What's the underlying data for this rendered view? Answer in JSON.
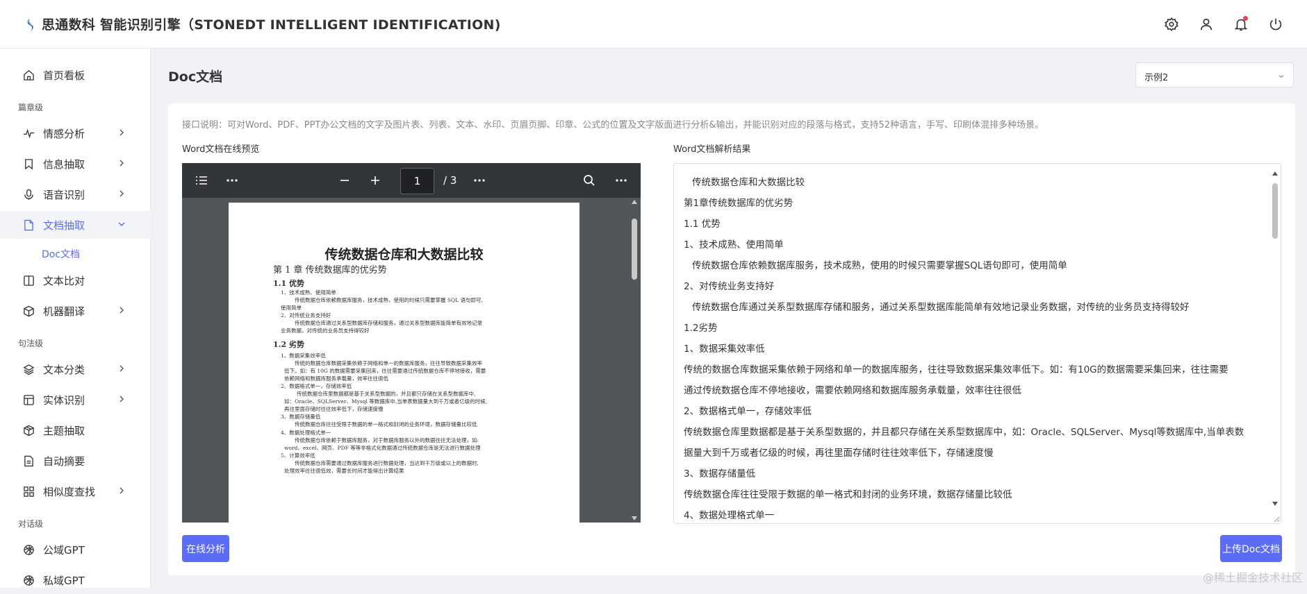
{
  "header": {
    "app_title": "思通数科 智能识别引擎（STONEDT INTELLIGENT IDENTIFICATION)",
    "icons": [
      "settings-icon",
      "user-icon",
      "bell-icon",
      "power-icon"
    ],
    "accent_color": "#5b6cf9"
  },
  "sidebar": {
    "items": [
      {
        "label": "首页看板",
        "icon": "home-icon"
      },
      {
        "group": "篇章级"
      },
      {
        "label": "情感分析",
        "icon": "pulse-icon",
        "has_arrow": true
      },
      {
        "label": "信息抽取",
        "icon": "bookmark-icon",
        "has_arrow": true
      },
      {
        "label": "语音识别",
        "icon": "mic-icon",
        "has_arrow": true
      },
      {
        "label": "文档抽取",
        "icon": "file-icon",
        "active": true,
        "expanded": true
      },
      {
        "sub": "Doc文档"
      },
      {
        "label": "文本比对",
        "icon": "columns-icon"
      },
      {
        "label": "机器翻译",
        "icon": "cube-icon",
        "has_arrow": true
      },
      {
        "group": "句法级"
      },
      {
        "label": "文本分类",
        "icon": "layers-icon",
        "has_arrow": true
      },
      {
        "label": "实体识别",
        "icon": "table-icon",
        "has_arrow": true
      },
      {
        "label": "主题抽取",
        "icon": "box-icon"
      },
      {
        "label": "自动摘要",
        "icon": "doc-icon"
      },
      {
        "label": "相似度查找",
        "icon": "grid-icon",
        "has_arrow": true
      },
      {
        "group": "对话级"
      },
      {
        "label": "公域GPT",
        "icon": "openai-icon"
      },
      {
        "label": "私域GPT",
        "icon": "openai-icon"
      }
    ]
  },
  "main": {
    "page_title": "Doc文档",
    "example_select": "示例2",
    "description": "接口说明：可对Word、PDF、PPT办公文档的文字及图片表、列表、文本、水印、页眉页脚、印章、公式的位置及文字版面进行分析&输出，并能识别对应的段落与格式，支持52种语言，手写、印刷体混排多种场景。",
    "preview_label": "Word文档在线预览",
    "result_label": "Word文档解析结果",
    "analyze_button": "在线分析",
    "upload_button": "上传Doc文档"
  },
  "viewer": {
    "page_number": "1",
    "page_total": "/ 3",
    "doc_title": "传统数据仓库和大数据比较",
    "lines": [
      {
        "text": "第 1 章    传统数据库的优劣势",
        "cls": "pdf-h1"
      },
      {
        "text": "1.1 优势",
        "cls": "pdf-h2"
      },
      {
        "text": "1、技术成熟、使用简单",
        "cls": "pdf-body"
      },
      {
        "text": "传统数据仓库依赖数据库服务，技术成熟，使用的时候只需要掌握 SQL 语句即可,",
        "cls": "pdf-body"
      },
      {
        "text": "使用简单",
        "cls": "pdf-body"
      },
      {
        "text": "2、对传统业务支持好",
        "cls": "pdf-body"
      },
      {
        "text": "传统数据仓库通过关系型数据库存储和服务，通过关系型数据库能简单有效地记录",
        "cls": "pdf-body"
      },
      {
        "text": "业务数据，对传统的业务员支持得较好",
        "cls": "pdf-body"
      },
      {
        "text": "1.2 劣势",
        "cls": "pdf-h2"
      },
      {
        "text": "1、数据采集效率低",
        "cls": "pdf-body"
      },
      {
        "text": "传统的数据仓库数据采集依赖于网络和单一的数据库服务，往往导致数据采集效率",
        "cls": "pdf-body"
      },
      {
        "text": "低下。如：有 10G 的数据需要采集回来，往往需要通过传统数据仓库不停地接收，需要",
        "cls": "pdf-body"
      },
      {
        "text": "依赖网络和数据库服务承载量，效率往往很低",
        "cls": "pdf-body"
      },
      {
        "text": "2、数据格式单一，存储效率低",
        "cls": "pdf-body"
      },
      {
        "text": "传统数据仓库里数据都是基于关系型数据的，并且都只存储在关系型数据库中,",
        "cls": "pdf-body"
      },
      {
        "text": "如：Oracle、SQLServer、Mysql 等数据库中,当单表数据量大到千万或者亿级的时候,",
        "cls": "pdf-body"
      },
      {
        "text": "再往里面存储时往往效率低下，存储速度慢",
        "cls": "pdf-body"
      },
      {
        "text": "3、数据存储量低",
        "cls": "pdf-body"
      },
      {
        "text": "传统数据仓库往往受限于数据的单一格式和封闭的业务环境，数据存储量比较低",
        "cls": "pdf-body"
      },
      {
        "text": "4、数据处理格式单一",
        "cls": "pdf-body"
      },
      {
        "text": "传统数据仓库依赖于数据库服务，对于数据库服务以外的数据往往无法处理，如:",
        "cls": "pdf-body"
      },
      {
        "text": "word、excel、网页、PDF 等等非格式化数据通过传统数据仓库是无法进行数据处理",
        "cls": "pdf-body"
      },
      {
        "text": "5、计算效率低",
        "cls": "pdf-body"
      },
      {
        "text": "传统数据仓库需要通过数据库服务进行数据处理，当达到千万级或以上的数据时,",
        "cls": "pdf-body"
      },
      {
        "text": "处理效率往往很低效，需要长时间才能得出计算结果",
        "cls": "pdf-body"
      }
    ]
  },
  "result": {
    "lines": [
      "传统数据仓库和大数据比较",
      "第1章传统数据库的优劣势",
      "1.1 优势",
      "1、技术成熟、使用简单",
      "传统数据仓库依赖数据库服务，技术成熟，使用的时候只需要掌握SQL语句即可，使用简单",
      "2、对传统业务支持好",
      "传统数据仓库通过关系型数据库存储和服务，通过关系型数据库能简单有效地记录业务数据，对传统的业务员支持得较好",
      "1.2劣势",
      "1、数据采集效率低",
      "传统的数据仓库数据采集依赖于网络和单一的数据库服务，往往导致数据采集效率低下。如：有10G的数据需要采集回来，往往需要",
      "通过传统数据仓库不停地接收，需要依赖网络和数据库服务承载量，效率往往很低",
      "2、数据格式单一，存储效率低",
      "传统数据仓库里数据都是基于关系型数据的，并且都只存储在关系型数据库中，如：Oracle、SQLServer、Mysql等数据库中,当单表数",
      "据量大到千万或者亿级的时候，再往里面存储时往往效率低下，存储速度慢",
      "3、数据存储量低",
      "传统数据仓库往往受限于数据的单一格式和封闭的业务环境，数据存储量比较低",
      "4、数据处理格式单一"
    ]
  },
  "watermark": "@稀土掘金技术社区"
}
